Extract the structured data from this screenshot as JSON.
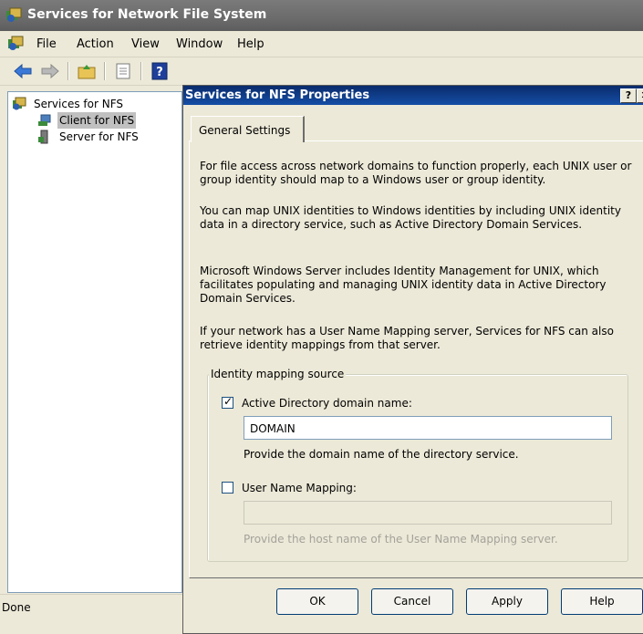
{
  "window": {
    "title": "Services for Network File System"
  },
  "menu": {
    "items": [
      "File",
      "Action",
      "View",
      "Window",
      "Help"
    ]
  },
  "toolbar": {
    "icons": [
      "back-arrow-icon",
      "forward-arrow-icon",
      "up-folder-icon",
      "properties-icon",
      "help-icon"
    ]
  },
  "tree": {
    "root": "Services for NFS",
    "items": [
      "Client for NFS",
      "Server for NFS"
    ],
    "selected": "Client for NFS"
  },
  "status": {
    "text": "Done"
  },
  "dialog": {
    "title": "Services for NFS Properties",
    "tab": "General Settings",
    "paragraphs": [
      "For file access across network domains to function properly, each UNIX user or group identity should map to a Windows user or group identity.",
      "You can map UNIX identities to Windows identities by including UNIX identity data in a directory service, such as Active Directory Domain Services.",
      "Microsoft Windows Server includes Identity Management for UNIX, which facilitates populating and managing UNIX identity data in Active Directory Domain Services.",
      "If your network has a User Name Mapping server, Services for NFS can also retrieve identity mappings from that server."
    ],
    "group_title": "Identity mapping source",
    "ad_label": "Active Directory domain name:",
    "ad_checked": true,
    "ad_value": "DOMAIN",
    "ad_hint": "Provide the domain name of the directory service.",
    "unm_label": "User Name Mapping:",
    "unm_checked": false,
    "unm_value": "",
    "unm_hint": "Provide the host name of the User Name Mapping server.",
    "buttons": {
      "ok": "OK",
      "cancel": "Cancel",
      "apply": "Apply",
      "help": "Help"
    }
  },
  "colors": {
    "title_active": "#0a2b6c",
    "title_inactive": "#6b6b6b",
    "selection": "#c0c0c0"
  }
}
